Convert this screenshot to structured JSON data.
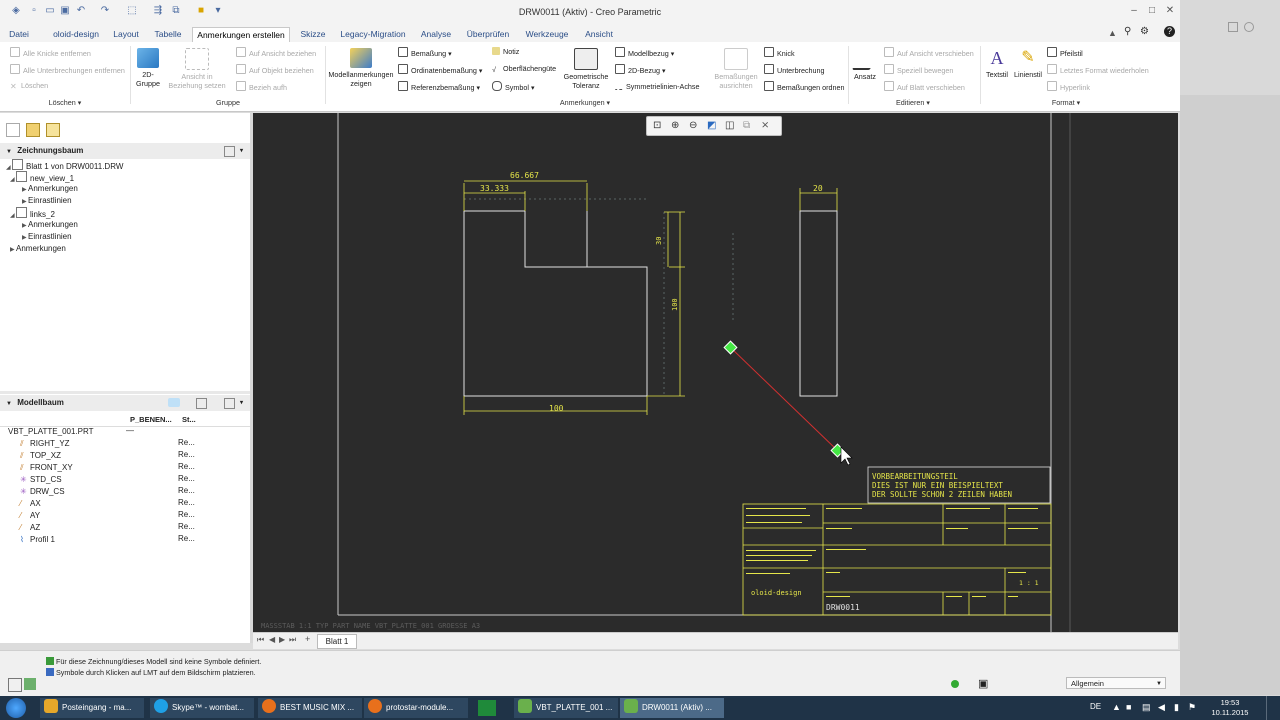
{
  "window": {
    "title": "DRW0011 (Aktiv) - Creo Parametric"
  },
  "tabs": [
    "Datei",
    "oloid-design",
    "Layout",
    "Tabelle",
    "Anmerkungen erstellen",
    "Skizze",
    "Legacy-Migration",
    "Analyse",
    "Überprüfen",
    "Werkzeuge",
    "Ansicht"
  ],
  "active_tab_index": 4,
  "ribbon": {
    "loeschen": {
      "items": [
        "Alle Knicke entfernen",
        "Alle Unterbrechungen entfernen",
        "Löschen"
      ],
      "group": "Löschen"
    },
    "gruppe": {
      "btn_2d": "2D-Gruppe",
      "btn_ansicht": "Ansicht in Beziehung setzen",
      "items": [
        "Auf Ansicht beziehen",
        "Auf Objekt beziehen",
        "Bezieh aufh"
      ],
      "group": "Gruppe"
    },
    "modellanm": "Modellanmerkungen zeigen",
    "anm_col1": [
      "Bemaßung",
      "Ordinatenbemaßung",
      "Referenzbemaßung"
    ],
    "anm_col2": [
      "Notiz",
      "Oberflächengüte",
      "Symbol"
    ],
    "geotol": "Geometrische Toleranz",
    "anm_col3": [
      "Modellbezug",
      "2D-Bezug",
      "Symmetrielinien-Achse"
    ],
    "bem_ausrichten": "Bemaßungen ausrichten",
    "anm_col4": [
      "Knick",
      "Unterbrechung",
      "Bemaßungen ordnen"
    ],
    "anm_group": "Anmerkungen",
    "ansatz": "Ansatz",
    "edit_col": [
      "Auf Ansicht verschieben",
      "Speziell bewegen",
      "Auf Blatt verschieben"
    ],
    "edit_group": "Editieren",
    "textstil": "Textstil",
    "linienstil": "Linienstil",
    "format_col": [
      "Pfeilstil",
      "Letztes Format wiederholen",
      "Hyperlink"
    ],
    "format_group": "Format"
  },
  "drawing_tree": {
    "title": "Zeichnungsbaum",
    "items": [
      "Blatt 1 von DRW0011.DRW",
      "new_view_1",
      "Anmerkungen",
      "Einrastlinien",
      "links_2",
      "Anmerkungen",
      "Einrastlinien",
      "Anmerkungen"
    ]
  },
  "model_tree": {
    "title": "Modellbaum",
    "col1": "P_BENEN...",
    "col2": "St...",
    "root": "VBT_PLATTE_001.PRT",
    "root_val": "—",
    "items": [
      {
        "name": "RIGHT_YZ",
        "val": "Re..."
      },
      {
        "name": "TOP_XZ",
        "val": "Re..."
      },
      {
        "name": "FRONT_XY",
        "val": "Re..."
      },
      {
        "name": "STD_CS",
        "val": "Re..."
      },
      {
        "name": "DRW_CS",
        "val": "Re..."
      },
      {
        "name": "AX",
        "val": "Re..."
      },
      {
        "name": "AY",
        "val": "Re..."
      },
      {
        "name": "AZ",
        "val": "Re..."
      },
      {
        "name": "Profil 1",
        "val": "Re..."
      }
    ]
  },
  "drawing": {
    "dims": {
      "d1": "66.667",
      "d2": "33.333",
      "d3": "30",
      "d4": "100",
      "d5": "100",
      "d6": "20"
    },
    "note": [
      "VORBEARBEITUNGSTEIL",
      "DIES IST NUR EIN BEISPIELTEXT",
      "DER SOLLTE SCHON 2 ZEILEN HABEN"
    ],
    "title_block": {
      "logo": "oloid-design",
      "drawing_no": "DRW0011",
      "scale": "1 : 1"
    },
    "bottom_text": "MASSSTAB 1:1   TYP PART   NAME VBT_PLATTE_001   GROESSE A3"
  },
  "sheet_tab": "Blatt 1",
  "status": {
    "line1": "Für diese Zeichnung/dieses Modell sind keine Symbole definiert.",
    "line2": "Symbole durch Klicken auf LMT auf dem Bildschirm platzieren.",
    "filter": "Allgemein"
  },
  "taskbar": {
    "apps": [
      "Posteingang - ma...",
      "Skype™ - wombat...",
      "BEST MUSIC MIX ...",
      "protostar-module...",
      "VBT_PLATTE_001 ...",
      "DRW0011 (Aktiv) ..."
    ],
    "lang": "DE",
    "time": "19:53",
    "date": "10.11.2015"
  }
}
